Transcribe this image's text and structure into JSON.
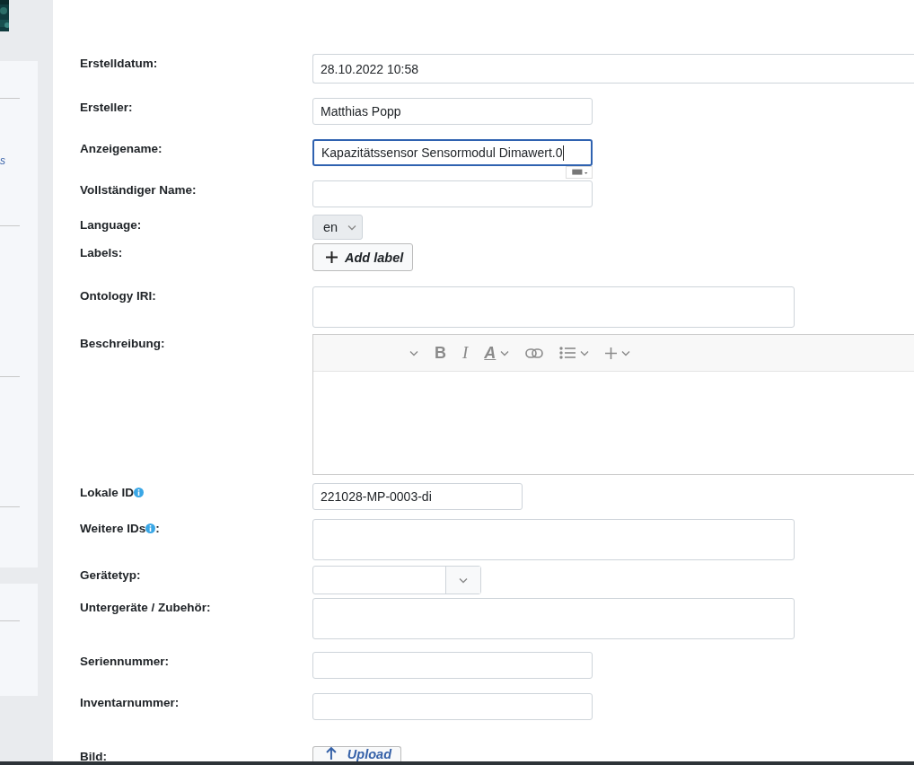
{
  "sidebar": {
    "link_fragment": "s"
  },
  "form": {
    "rows": [
      {
        "label": "Erstelldatum:",
        "kind": "readonly",
        "value": "28.10.2022 10:58"
      },
      {
        "label": "Ersteller:",
        "kind": "input",
        "value": "Matthias Popp"
      },
      {
        "label": "Anzeigename:",
        "kind": "input",
        "value": "Kapazitätssensor Sensormodul Dimawert.0",
        "focused": true
      },
      {
        "label": "Vollständiger Name:",
        "kind": "input"
      },
      {
        "label": "Language:",
        "kind": "select",
        "value": "en"
      },
      {
        "label": "Labels:",
        "kind": "button",
        "button": "Add label"
      },
      {
        "label": "Ontology IRI:",
        "kind": "textarea"
      },
      {
        "label": "Beschreibung:",
        "kind": "editor",
        "toolbar": [
          {
            "kind": "heading"
          },
          {
            "kind": "bold",
            "label": "B"
          },
          {
            "kind": "italic",
            "label": "I"
          },
          {
            "kind": "color",
            "label": "A"
          },
          {
            "kind": "link"
          },
          {
            "kind": "list"
          },
          {
            "kind": "insert"
          }
        ]
      },
      {
        "label": "Lokale ID",
        "info": true,
        "kind": "short",
        "value": "221028-MP-0003-di"
      },
      {
        "label": "Weitere IDs",
        "info": true,
        "suffix": ":",
        "kind": "textarea"
      },
      {
        "label": "Gerätetyp:",
        "kind": "combo"
      },
      {
        "label": "Untergeräte / Zubehör:",
        "kind": "textarea"
      },
      {
        "label": "Seriennummer:",
        "kind": "input"
      },
      {
        "label": "Inventarnummer:",
        "kind": "input"
      },
      {
        "label": "Bild:",
        "kind": "upload",
        "button": "Upload"
      }
    ]
  }
}
